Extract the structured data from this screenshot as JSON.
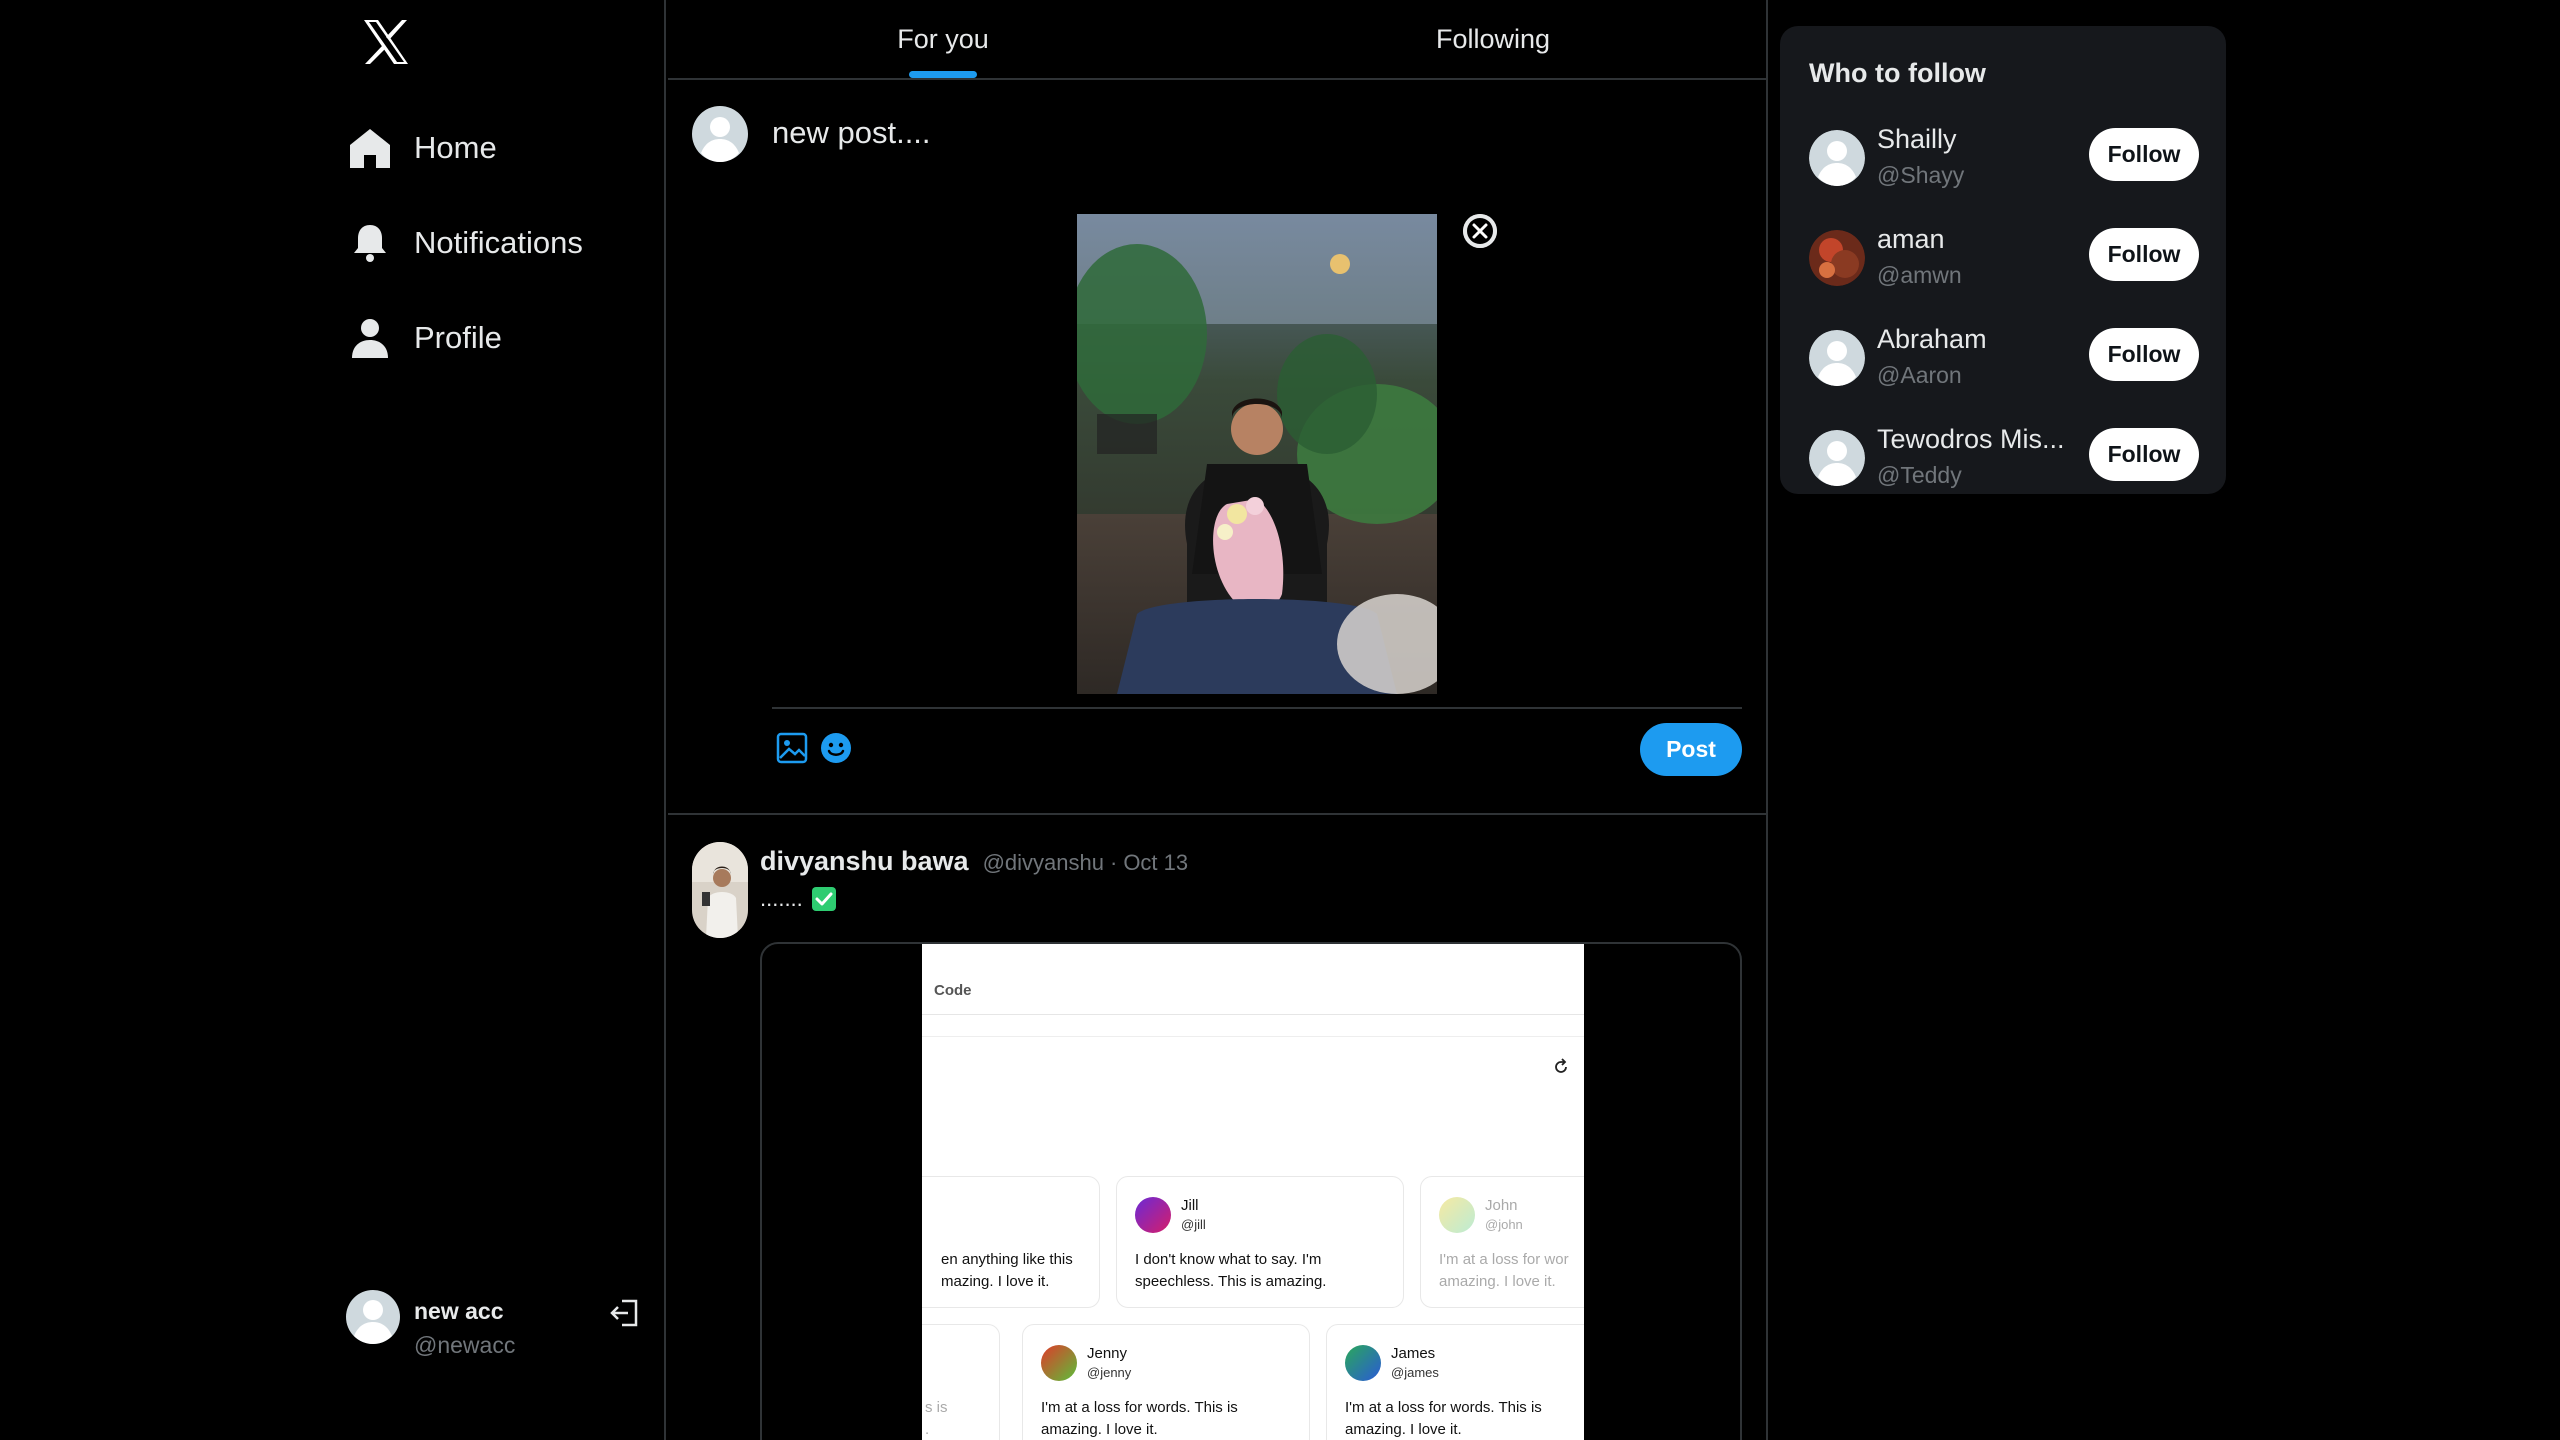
{
  "app": {
    "logo_icon": "x-logo-icon"
  },
  "nav": {
    "items": [
      {
        "label": "Home",
        "icon": "home-icon"
      },
      {
        "label": "Notifications",
        "icon": "bell-icon"
      },
      {
        "label": "Profile",
        "icon": "person-icon"
      }
    ]
  },
  "account": {
    "name": "new acc",
    "handle": "@newacc",
    "logout_icon": "logout-icon"
  },
  "tabs": [
    {
      "label": "For you",
      "active": true
    },
    {
      "label": "Following",
      "active": false
    }
  ],
  "composer": {
    "value": "new post....",
    "media_icon": "image-icon",
    "emoji_icon": "emoji-icon",
    "remove_icon": "close-icon",
    "post_label": "Post"
  },
  "post": {
    "name": "divyanshu bawa",
    "handle": "@divyanshu",
    "separator": "·",
    "date": "Oct 13",
    "text": ".......",
    "check_icon": "check-box-icon",
    "embedded": {
      "tab": "Code",
      "cards": [
        {
          "name": "",
          "handle": "",
          "body": "en anything like this\nmazing. I love it."
        },
        {
          "name": "Jill",
          "handle": "@jill",
          "body": "I don't know what to say. I'm speechless. This is amazing."
        },
        {
          "name": "John",
          "handle": "@john",
          "body": "I'm at a loss for wor\namazing. I love it."
        },
        {
          "name": "",
          "handle": "",
          "body": "s is\n."
        },
        {
          "name": "Jenny",
          "handle": "@jenny",
          "body": "I'm at a loss for words. This is amazing. I love it."
        },
        {
          "name": "James",
          "handle": "@james",
          "body": "I'm at a loss for words. This is\namazing. I love it."
        }
      ]
    }
  },
  "who_to_follow": {
    "title": "Who to follow",
    "users": [
      {
        "name": "Shailly",
        "handle": "@Shayy",
        "follow_label": "Follow"
      },
      {
        "name": "aman",
        "handle": "@amwn",
        "follow_label": "Follow"
      },
      {
        "name": "Abraham",
        "handle": "@Aaron",
        "follow_label": "Follow"
      },
      {
        "name": "Tewodros Mis...",
        "handle": "@Teddy",
        "follow_label": "Follow"
      }
    ]
  },
  "colors": {
    "accent": "#1d9bf0",
    "background": "#000000",
    "panel": "#16181c",
    "muted": "#71767b"
  }
}
